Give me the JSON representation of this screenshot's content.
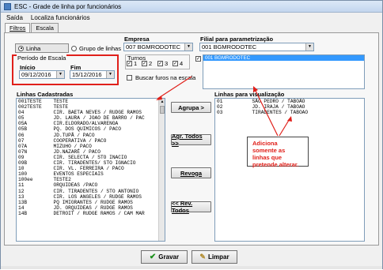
{
  "window": {
    "title": "ESC - Grade de linha por funcionários"
  },
  "menu": {
    "items": [
      "Saída",
      "Localiza funcionários"
    ]
  },
  "tabs": [
    "Filtros",
    "Escala"
  ],
  "filters": {
    "mode_linha": "Linha",
    "mode_grupo": "Grupo de linhas",
    "period_legend": "Período de Escala",
    "inicio_label": "Início",
    "inicio_value": "09/12/2016",
    "fim_label": "Fim",
    "fim_value": "15/12/2016",
    "empresa_label": "Empresa",
    "empresa_value": "007 BGMRODOTEC",
    "filial_label": "Filial para parametrização",
    "filial_value": "001 BGMRODOTEC",
    "turnos_label": "Turnos",
    "turnos": [
      "1",
      "2",
      "3",
      "4"
    ],
    "buscar_furos": "Buscar furos na escala",
    "filial_list": [
      "001 BGMRODOTEC"
    ]
  },
  "linhas_cadastradas": {
    "label": "Linhas Cadastradas",
    "rows": [
      "001TESTE    TESTE",
      "002TESTE    TESTE",
      "04          CIR. BAETA NEVES / RUDGE RAMOS",
      "05          JD. LAURA / JOAO DE BARRO / PAC",
      "05A         CIR.ELDORADO/ALVARENGA",
      "05B         PQ. DOS QUIMICOS / PACO",
      "06          JD.TUPÃ / PACO",
      "07          COOPERATIVA / PACO",
      "07A         MIZUHO / PACO",
      "07N         JD.NAZARÉ / PACO",
      "09          CIR. SELECTA / STO INACIO",
      "09B         CIR. TIRADENTES/ STO IGNACIO",
      "10          CIR. VL. FERREIRA / PACO",
      "100         EVENTOS ESPECIAIS",
      "100ee       TESTE2",
      "11          ORQUIDEAS /PACO",
      "12          CIR. TIRADENTES / STO ANTONIO",
      "13          CIR. LOS ANGELES / RUDGE RAMOS",
      "13B         PQ IMIGRANTES / RUDGE RAMOS",
      "14          JD. ORQUIDEAS / RUDGE RAMOS",
      "14B         DETROIT / RUDGE RAMOS / CAM MAR"
    ]
  },
  "linhas_visualizacao": {
    "label": "Linhas para visualização",
    "rows": [
      "01          SÃO PEDRO / TABOÃO",
      "02          JD. IRAJA / TABOAO",
      "03          TIRADENTES / TABOAO"
    ]
  },
  "buttons": {
    "agrupa": "Agrupa >",
    "agr_todos": "Agr. Todos >>",
    "revoga": "Revoga",
    "rev_todos": "<< Rev. Todos",
    "gravar": "Gravar",
    "limpar": "Limpar"
  },
  "callout": "Adiciona somente as linhas que pretende alterar.",
  "colors": {
    "highlight": "#e0201a",
    "selection": "#3399ff"
  }
}
